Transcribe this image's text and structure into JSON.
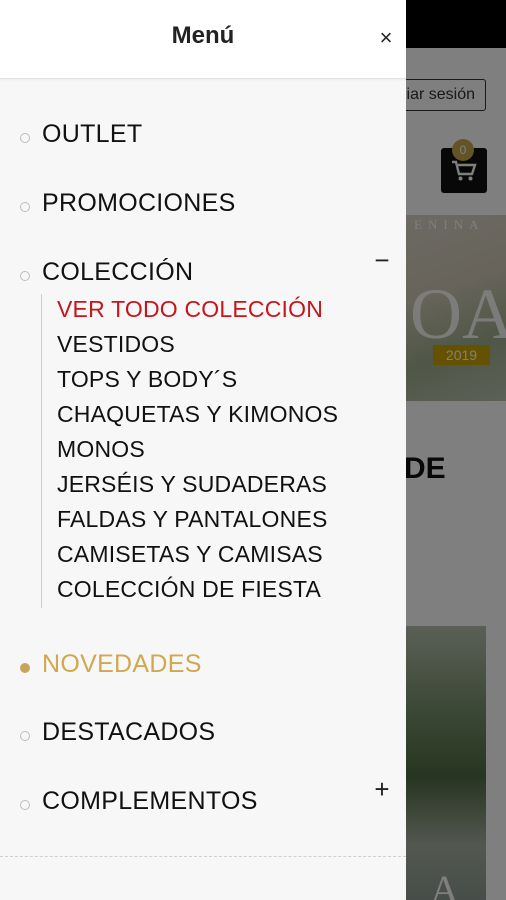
{
  "background": {
    "login_label": "Iniciar sesión",
    "cart_count": "0",
    "hero_text": "ENINA",
    "hero_big": "OA",
    "year_badge": "2019",
    "heading_fragment": "DE",
    "photo_letter": "A"
  },
  "drawer": {
    "title": "Menú",
    "close_label": "×",
    "items": [
      {
        "label": "OUTLET"
      },
      {
        "label": "PROMOCIONES"
      },
      {
        "label": "COLECCIÓN",
        "toggle": "−"
      },
      {
        "label": "NOVEDADES"
      },
      {
        "label": "DESTACADOS"
      },
      {
        "label": "COMPLEMENTOS",
        "toggle": "+"
      }
    ],
    "submenu": [
      "VER TODO COLECCIÓN",
      "VESTIDOS",
      "TOPS Y BODY´S",
      "CHAQUETAS Y KIMONOS",
      "MONOS",
      "JERSÉIS Y SUDADERAS",
      "FALDAS Y PANTALONES",
      "CAMISETAS Y CAMISAS",
      "COLECCIÓN DE FIESTA"
    ]
  },
  "colors": {
    "accent_gold": "#d1a84e",
    "active_red": "#c4161c"
  }
}
